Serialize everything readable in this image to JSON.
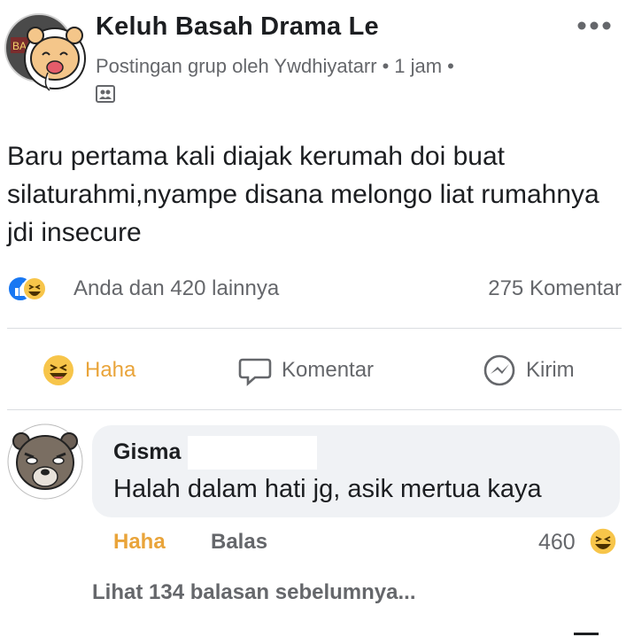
{
  "post": {
    "group_name": "Keluh Basah Drama Le",
    "meta_prefix": "Postingan grup oleh",
    "author": "Ywdhiyatarr",
    "time": "1 jam",
    "body": "Baru pertama kali diajak kerumah doi buat silaturahmi,nyampe disana melongo liat rumahnya jdi insecure",
    "avatar_text": "BAS"
  },
  "reactions": {
    "summary": "Anda dan 420 lainnya",
    "comments": "275 Komentar",
    "icons": [
      "like-icon",
      "haha-icon"
    ]
  },
  "actions": {
    "haha": "Haha",
    "comment": "Komentar",
    "send": "Kirim"
  },
  "comment": {
    "name": "Gisma",
    "text": "Halah dalam hati jg, asik mertua kaya",
    "haha_label": "Haha",
    "reply_label": "Balas",
    "reaction_count": "460"
  },
  "view_replies": "Lihat 134 balasan sebelumnya...",
  "colors": {
    "haha": "#e9a43a",
    "like": "#1877f2",
    "muted_text": "#65676b",
    "bubble": "#f0f2f5"
  }
}
